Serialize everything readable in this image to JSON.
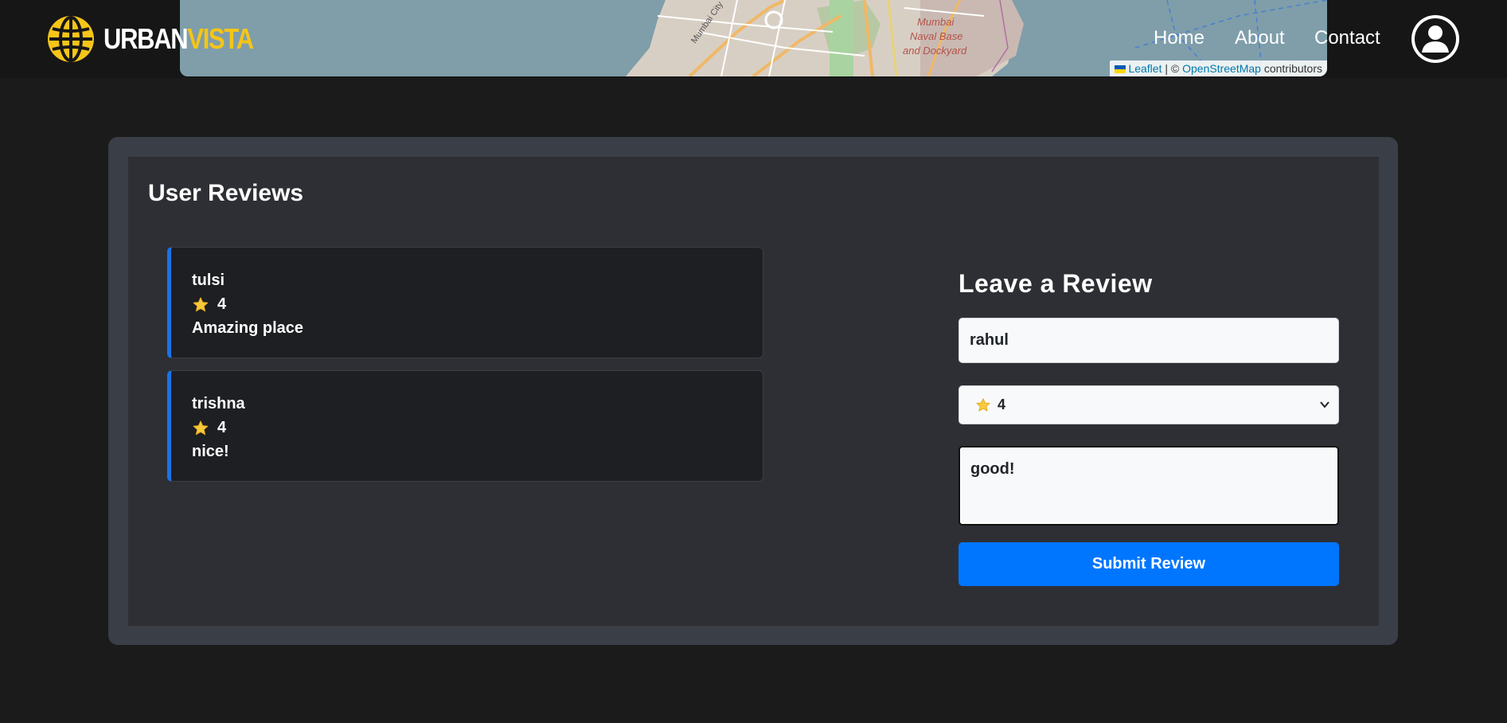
{
  "brand": {
    "word1": "URBAN",
    "word2": "VISTA",
    "accent_color": "#f5c518"
  },
  "map": {
    "labels": [
      "Mumbai",
      "Naval Base",
      "and Dockyard"
    ],
    "road_label": "Mumbai City",
    "attribution": {
      "leaflet": "Leaflet",
      "separator": " | © ",
      "osm": "OpenStreetMap",
      "suffix": " contributors"
    }
  },
  "nav": {
    "home": "Home",
    "about": "About",
    "contact": "Contact",
    "profile_icon": "user-avatar-icon"
  },
  "reviews": {
    "title": "User Reviews",
    "items": [
      {
        "name": "tulsi",
        "rating": "4",
        "text": "Amazing place"
      },
      {
        "name": "trishna",
        "rating": "4",
        "text": "nice!"
      }
    ],
    "accent_color": "#1a73e8"
  },
  "form": {
    "title": "Leave a Review",
    "name_value": "rahul",
    "rating_value": "4",
    "comment_value": "good!",
    "submit_label": "Submit Review",
    "button_color": "#0076ff"
  }
}
